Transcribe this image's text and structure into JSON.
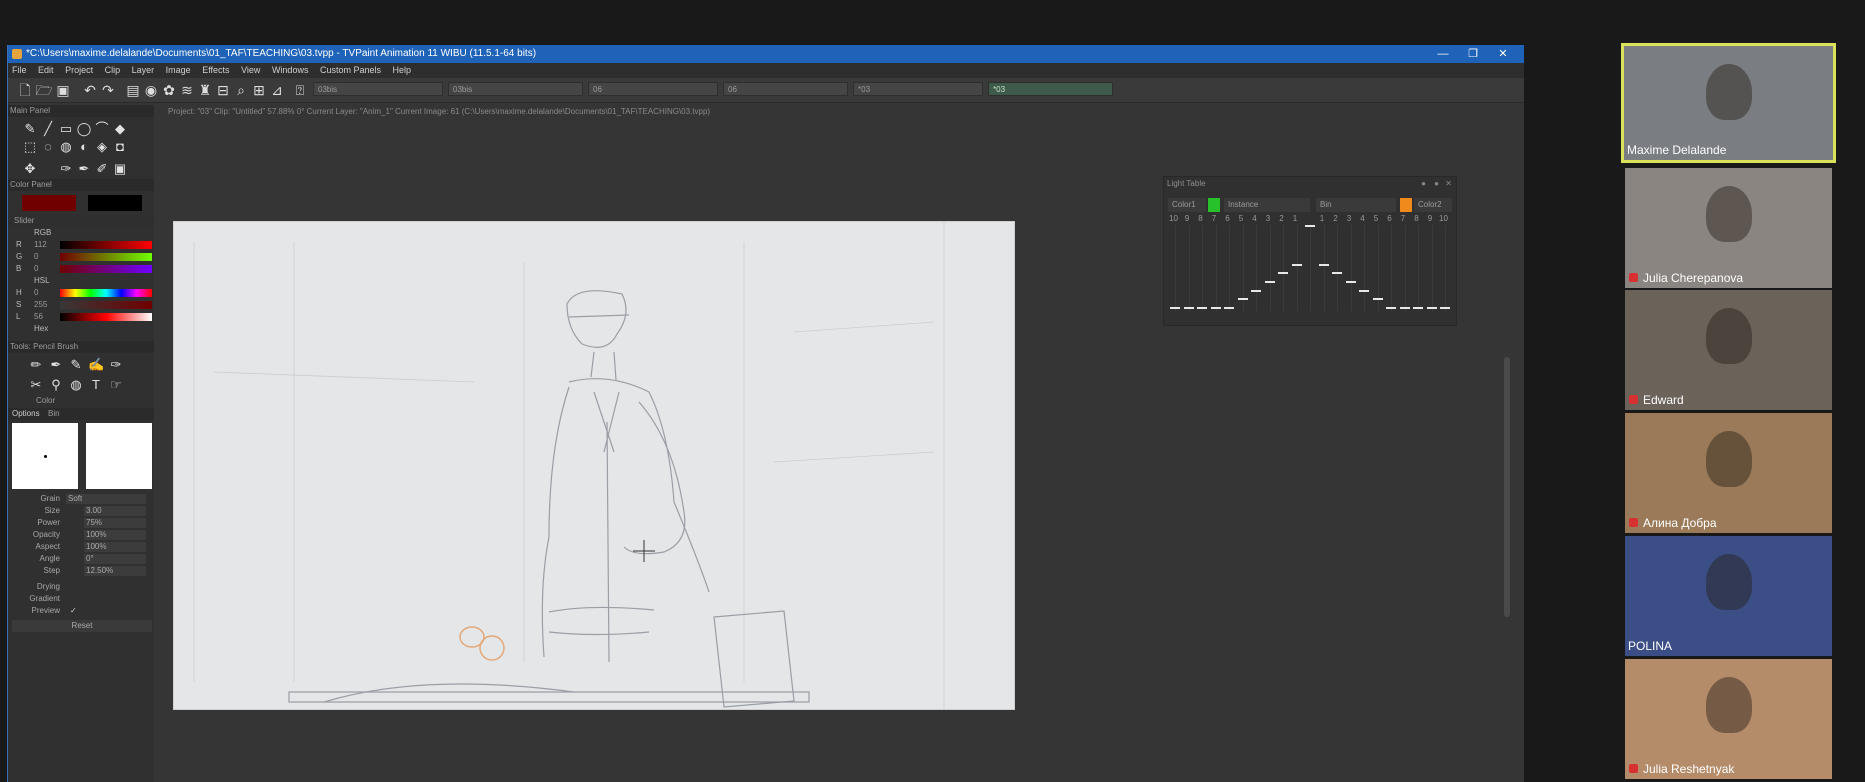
{
  "window": {
    "title": "*C:\\Users\\maxime.delalande\\Documents\\01_TAF\\TEACHING\\03.tvpp - TVPaint Animation 11 WIBU (11.5.1-64 bits)",
    "minimize": "—",
    "maximize": "❐",
    "close": "✕"
  },
  "menu": [
    "File",
    "Edit",
    "Project",
    "Clip",
    "Layer",
    "Image",
    "Effects",
    "View",
    "Windows",
    "Custom Panels",
    "Help"
  ],
  "toolbar": {
    "fields": [
      "03bis",
      "03bis",
      "06",
      "06",
      "*03",
      "*03"
    ],
    "active_field_index": 4
  },
  "info_bar": "Project: \"03\"  Clip: \"Untitled\"  57.88%  0°  Current Layer: \"Anim_1\"  Current Image: 61 (C:\\Users\\maxime.delalande\\Documents\\01_TAF\\TEACHING\\03.tvpp)",
  "panels": {
    "main_panel": "Main Panel",
    "color_panel": "Color Panel",
    "slider": "Slider",
    "tools_panel": "Tools: Pencil Brush",
    "options_tab": "Options",
    "bin_tab": "Bin",
    "color_label": "Color",
    "reset_button": "Reset"
  },
  "colors": {
    "primary": "#700000",
    "secondary": "#000000",
    "accent_blue": "#1f63b8",
    "speaker_highlight": "#d9e25a"
  },
  "sliders": {
    "rgb_label": "RGB",
    "hsl_label": "HSL",
    "hex_label": "Hex",
    "rows": [
      {
        "label": "R",
        "value": "112",
        "gradient": "linear-gradient(90deg,#000,#ff0000)"
      },
      {
        "label": "G",
        "value": "0",
        "gradient": "linear-gradient(90deg,#700000,#70ff00)"
      },
      {
        "label": "B",
        "value": "0",
        "gradient": "linear-gradient(90deg,#700000,#7000ff)"
      },
      {
        "label": "H",
        "value": "0",
        "gradient": "linear-gradient(90deg,#f00,#ff0,#0f0,#0ff,#00f,#f0f,#f00)"
      },
      {
        "label": "S",
        "value": "255",
        "gradient": "linear-gradient(90deg,#383838,#700000)"
      },
      {
        "label": "L",
        "value": "56",
        "gradient": "linear-gradient(90deg,#000,#ff0000,#fff)"
      }
    ]
  },
  "options": {
    "grain_label": "Grain",
    "grain_value": "Soft",
    "rows": [
      {
        "label": "Size",
        "value": "3.00"
      },
      {
        "label": "Power",
        "value": "75%"
      },
      {
        "label": "Opacity",
        "value": "100%"
      },
      {
        "label": "Aspect",
        "value": "100%"
      },
      {
        "label": "Angle",
        "value": "0°"
      },
      {
        "label": "Step",
        "value": "12.50%"
      }
    ],
    "drying_label": "Drying",
    "gradient_label": "Gradient",
    "preview_label": "Preview"
  },
  "lighttable": {
    "title": "Light Table",
    "color1": "Color1",
    "instance": "Instance",
    "bin": "Bin",
    "color2": "Color2",
    "color1_swatch": "#27c22a",
    "color2_swatch": "#f08a1c",
    "numbers": [
      "10",
      "9",
      "8",
      "7",
      "6",
      "5",
      "4",
      "3",
      "2",
      "1",
      "",
      "1",
      "2",
      "3",
      "4",
      "5",
      "6",
      "7",
      "8",
      "9",
      "10"
    ],
    "levels": [
      0.05,
      0.05,
      0.05,
      0.05,
      0.05,
      0.15,
      0.25,
      0.35,
      0.45,
      0.55,
      1.0,
      0.55,
      0.45,
      0.35,
      0.25,
      0.15,
      0.05,
      0.05,
      0.05,
      0.05,
      0.05
    ]
  },
  "participants": [
    {
      "name": "Maxime Delalande",
      "active": true,
      "muted": false,
      "bg": "#7a7d82"
    },
    {
      "name": "Julia Cherepanova",
      "active": false,
      "muted": true,
      "bg": "#8a8580"
    },
    {
      "name": "Edward",
      "active": false,
      "muted": true,
      "bg": "#6b625a"
    },
    {
      "name": "Алина Добра",
      "active": false,
      "muted": true,
      "bg": "#9a7a58"
    },
    {
      "name": "POLINA",
      "active": false,
      "muted": false,
      "bg": "#3b4f86"
    },
    {
      "name": "Julia Reshetnyak",
      "active": false,
      "muted": true,
      "bg": "#b48c6a"
    }
  ]
}
